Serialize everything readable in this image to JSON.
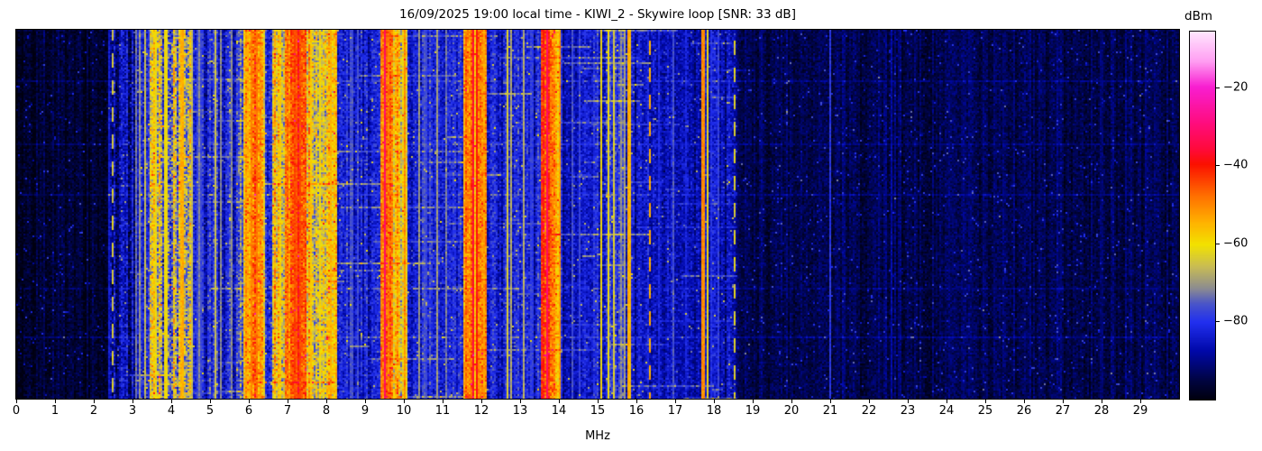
{
  "figure": {
    "title": "16/09/2025 19:00 local time - KIWI_2 - Skywire loop [SNR: 33 dB]",
    "xlabel": "MHz",
    "colorbar_label": "dBm"
  },
  "axes": {
    "x_ticks": [
      "0",
      "1",
      "2",
      "3",
      "4",
      "5",
      "6",
      "7",
      "8",
      "9",
      "10",
      "11",
      "12",
      "13",
      "14",
      "15",
      "16",
      "17",
      "18",
      "19",
      "20",
      "21",
      "22",
      "23",
      "24",
      "25",
      "26",
      "27",
      "28",
      "29"
    ],
    "x_range_mhz": [
      0,
      30
    ],
    "colorbar_ticks": [
      "−20",
      "−40",
      "−60",
      "−80"
    ],
    "colorbar_tick_values": [
      -20,
      -40,
      -60,
      -80
    ]
  },
  "chart_data": {
    "type": "heatmap",
    "subtype": "spectrogram-waterfall",
    "title": "16/09/2025 19:00 local time - KIWI_2 - Skywire loop [SNR: 33 dB]",
    "datetime_local": "16/09/2025 19:00",
    "station": "KIWI_2",
    "antenna": "Skywire loop",
    "snr_db": 33,
    "xlabel": "MHz",
    "x_range": [
      0,
      30
    ],
    "value_units": "dBm",
    "value_range": [
      -100,
      -5.7
    ],
    "legend_position": "right-colorbar",
    "grid": false,
    "colormap_stops": [
      [
        0.0,
        "#000010"
      ],
      [
        0.05,
        "#000440"
      ],
      [
        0.13,
        "#0008a8"
      ],
      [
        0.21,
        "#2230f0"
      ],
      [
        0.26,
        "#4a55c8"
      ],
      [
        0.3,
        "#8a8a92"
      ],
      [
        0.36,
        "#c8bc55"
      ],
      [
        0.42,
        "#f2e200"
      ],
      [
        0.48,
        "#ffb300"
      ],
      [
        0.55,
        "#ff7300"
      ],
      [
        0.64,
        "#fb1000"
      ],
      [
        0.68,
        "#ff0a3a"
      ],
      [
        0.75,
        "#ff0c7c"
      ],
      [
        0.85,
        "#f81ed1"
      ],
      [
        0.92,
        "#ff9ef2"
      ],
      [
        1.0,
        "#ffe6fe"
      ]
    ],
    "noise_segments": [
      [
        0.0,
        2.36,
        -97,
        5
      ],
      [
        2.36,
        3.2,
        -88,
        9
      ],
      [
        3.2,
        3.42,
        -84,
        9
      ],
      [
        3.42,
        4.5,
        -70,
        16
      ],
      [
        4.5,
        5.72,
        -83,
        9
      ],
      [
        5.72,
        5.88,
        -76,
        12
      ],
      [
        5.88,
        6.42,
        -54,
        12
      ],
      [
        6.42,
        6.6,
        -80,
        10
      ],
      [
        6.6,
        6.95,
        -62,
        14
      ],
      [
        6.95,
        7.48,
        -47,
        9
      ],
      [
        7.48,
        8.08,
        -63,
        14
      ],
      [
        8.08,
        8.3,
        -58,
        11
      ],
      [
        8.3,
        9.38,
        -83,
        8
      ],
      [
        9.38,
        9.7,
        -49,
        9
      ],
      [
        9.7,
        9.97,
        -60,
        12
      ],
      [
        9.97,
        10.07,
        -56,
        9
      ],
      [
        10.07,
        11.55,
        -83,
        8
      ],
      [
        11.55,
        12.12,
        -51,
        9
      ],
      [
        12.12,
        13.55,
        -84,
        8
      ],
      [
        13.55,
        13.92,
        -48,
        9
      ],
      [
        13.92,
        14.06,
        -58,
        9
      ],
      [
        14.06,
        15.0,
        -85,
        7
      ],
      [
        15.0,
        15.78,
        -81,
        9
      ],
      [
        15.78,
        18.55,
        -86,
        7
      ],
      [
        18.55,
        30.0,
        -94,
        5
      ]
    ],
    "spectral_lines": [
      [
        2.38,
        -80,
        0.02,
        0
      ],
      [
        2.5,
        -61,
        0.02,
        1
      ],
      [
        3.08,
        -70,
        0.02,
        0
      ],
      [
        3.2,
        -67,
        0.02,
        0
      ],
      [
        3.33,
        -65,
        0.02,
        0
      ],
      [
        3.55,
        -57,
        0.03,
        0
      ],
      [
        3.62,
        -58,
        0.02,
        0
      ],
      [
        3.86,
        -56,
        0.03,
        0
      ],
      [
        4.28,
        -50,
        0.03,
        0
      ],
      [
        4.55,
        -63,
        0.03,
        0
      ],
      [
        4.72,
        -72,
        0.05,
        0
      ],
      [
        5.14,
        -66,
        0.02,
        0
      ],
      [
        5.3,
        -66,
        0.02,
        0
      ],
      [
        5.55,
        -70,
        0.03,
        0
      ],
      [
        5.95,
        -51,
        0.03,
        0
      ],
      [
        6.07,
        -49,
        0.03,
        0
      ],
      [
        6.2,
        -47,
        0.04,
        0
      ],
      [
        6.3,
        -52,
        0.03,
        0
      ],
      [
        6.8,
        -56,
        0.03,
        0
      ],
      [
        7.2,
        -43,
        0.06,
        0
      ],
      [
        7.32,
        -44,
        0.04,
        0
      ],
      [
        7.6,
        -56,
        0.03,
        0
      ],
      [
        7.85,
        -57,
        0.03,
        0
      ],
      [
        8.12,
        -54,
        0.03,
        0
      ],
      [
        8.22,
        -56,
        0.02,
        0
      ],
      [
        8.65,
        -74,
        0.06,
        0
      ],
      [
        8.82,
        -76,
        0.04,
        0
      ],
      [
        9.51,
        -31,
        0.03,
        0
      ],
      [
        9.62,
        -48,
        0.03,
        0
      ],
      [
        10.02,
        -52,
        0.03,
        0
      ],
      [
        10.4,
        -69,
        0.02,
        0
      ],
      [
        10.55,
        -74,
        0.05,
        0
      ],
      [
        10.85,
        -67,
        0.02,
        0
      ],
      [
        11.1,
        -71,
        0.02,
        0
      ],
      [
        11.77,
        -31,
        0.025,
        0
      ],
      [
        11.9,
        -35,
        0.02,
        0
      ],
      [
        12.05,
        -50,
        0.03,
        0
      ],
      [
        12.68,
        -63,
        0.02,
        0
      ],
      [
        12.78,
        -65,
        0.02,
        0
      ],
      [
        13.1,
        -66,
        0.02,
        0
      ],
      [
        13.3,
        -74,
        0.03,
        0
      ],
      [
        13.7,
        -31,
        0.025,
        0
      ],
      [
        14.02,
        -52,
        0.03,
        0
      ],
      [
        14.35,
        -76,
        0.03,
        0
      ],
      [
        14.55,
        -75,
        0.03,
        0
      ],
      [
        15.1,
        -58,
        0.025,
        0
      ],
      [
        15.28,
        -61,
        0.02,
        0
      ],
      [
        15.44,
        -58,
        0.025,
        0
      ],
      [
        15.62,
        -68,
        0.03,
        0
      ],
      [
        15.72,
        -64,
        0.02,
        0
      ],
      [
        15.81,
        -50,
        0.03,
        0
      ],
      [
        16.36,
        -52,
        0.035,
        1
      ],
      [
        16.6,
        -77,
        0.02,
        0
      ],
      [
        16.95,
        -75,
        0.02,
        0
      ],
      [
        17.3,
        -78,
        0.02,
        0
      ],
      [
        17.72,
        -46,
        0.03,
        0
      ],
      [
        17.82,
        -57,
        0.025,
        0
      ],
      [
        17.95,
        -75,
        0.02,
        0
      ],
      [
        18.1,
        -74,
        0.02,
        0
      ],
      [
        18.53,
        -62,
        0.025,
        1
      ],
      [
        21.0,
        -79,
        0.025,
        0
      ],
      [
        22.6,
        -83,
        0.02,
        0
      ],
      [
        28.0,
        -86,
        0.02,
        0
      ]
    ]
  }
}
